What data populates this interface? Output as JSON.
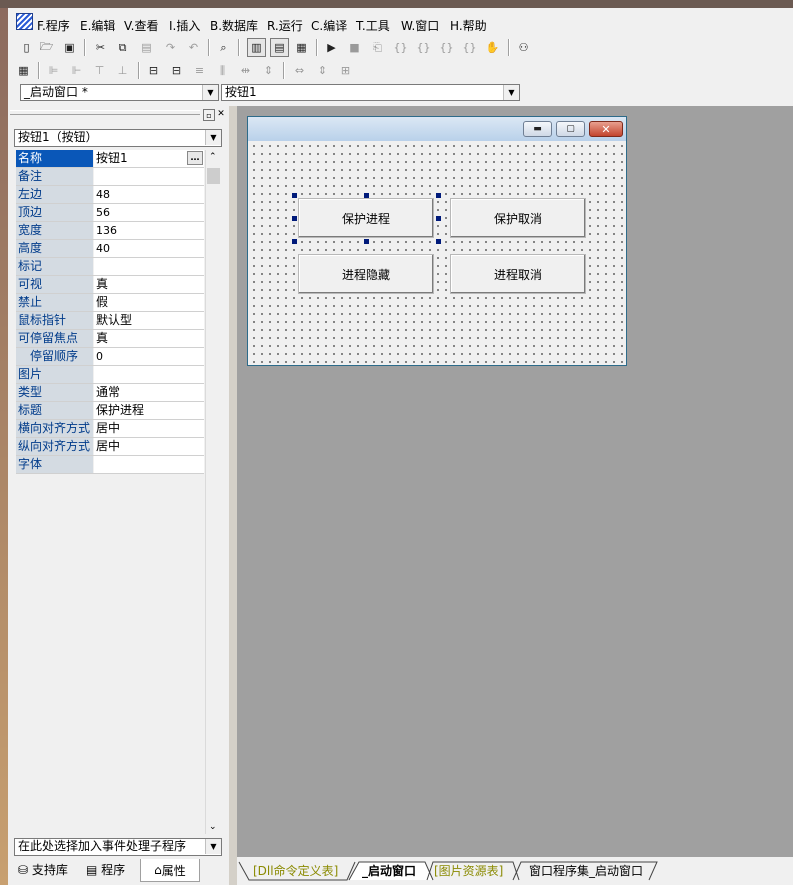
{
  "menu": [
    "F.程序",
    "E.编辑",
    "V.查看",
    "I.插入",
    "B.数据库",
    "R.运行",
    "C.编译",
    "T.工具",
    "W.窗口",
    "H.帮助"
  ],
  "toolbar": {
    "window_combo": "_启动窗口 *",
    "component_combo": "按钮1"
  },
  "props": {
    "object_combo": "按钮1（按钮）",
    "rows": [
      {
        "name": "名称",
        "value": "按钮1"
      },
      {
        "name": "备注",
        "value": ""
      },
      {
        "name": "左边",
        "value": "48"
      },
      {
        "name": "顶边",
        "value": "56"
      },
      {
        "name": "宽度",
        "value": "136"
      },
      {
        "name": "高度",
        "value": "40"
      },
      {
        "name": "标记",
        "value": ""
      },
      {
        "name": "可视",
        "value": "真"
      },
      {
        "name": "禁止",
        "value": "假"
      },
      {
        "name": "鼠标指针",
        "value": "默认型"
      },
      {
        "name": "可停留焦点",
        "value": "真"
      },
      {
        "name": "停留顺序",
        "value": "0"
      },
      {
        "name": "图片",
        "value": ""
      },
      {
        "name": "类型",
        "value": "通常"
      },
      {
        "name": "标题",
        "value": "保护进程"
      },
      {
        "name": "横向对齐方式",
        "value": "居中"
      },
      {
        "name": "纵向对齐方式",
        "value": "居中"
      },
      {
        "name": "字体",
        "value": ""
      }
    ],
    "event_combo": "在此处选择加入事件处理子程序",
    "ellipsis": "…"
  },
  "left_tabs": {
    "support": "支持库",
    "program": "程序",
    "properties": "属性"
  },
  "form": {
    "buttons": {
      "protect": "保护进程",
      "cancel_protect": "保护取消",
      "hide": "进程隐藏",
      "cancel_hide": "进程取消"
    }
  },
  "bottom_tabs": {
    "dll": "[Dll命令定义表]",
    "startup": "_启动窗口",
    "images": "[图片资源表]",
    "window_set": "窗口程序集_启动窗口"
  }
}
